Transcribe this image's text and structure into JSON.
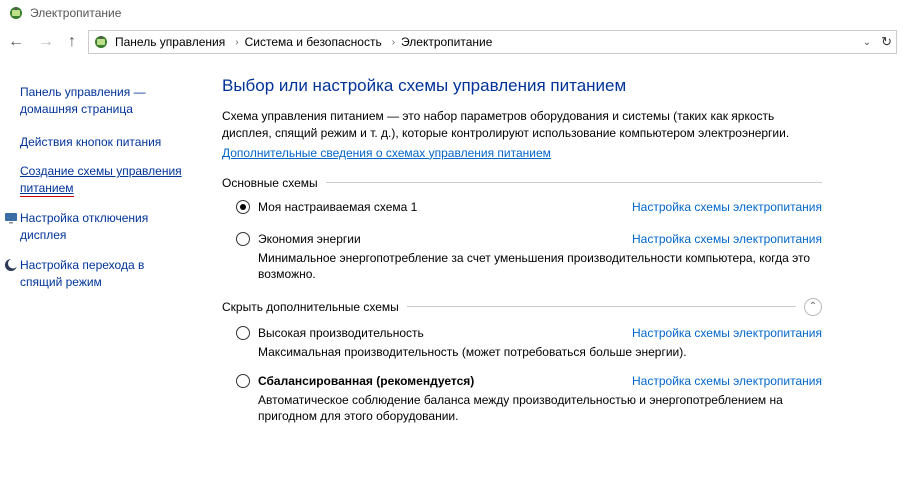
{
  "window": {
    "title": "Электропитание"
  },
  "breadcrumb": {
    "root": "Панель управления",
    "cat": "Система и безопасность",
    "page": "Электропитание"
  },
  "sidebar": {
    "home1": "Панель управления —",
    "home2": "домашняя страница",
    "links": {
      "buttons": "Действия кнопок питания",
      "create1": "Создание схемы управления",
      "create2": "питанием",
      "display1": "Настройка отключения",
      "display2": "дисплея",
      "sleep1": "Настройка перехода в",
      "sleep2": "спящий режим"
    }
  },
  "main": {
    "heading": "Выбор или настройка схемы управления питанием",
    "intro": "Схема управления питанием — это набор параметров оборудования и системы (таких как яркость дисплея, спящий режим и т. д.), которые контролируют использование компьютером электроэнергии.",
    "more": "Дополнительные сведения о схемах управления питанием",
    "group_basic": "Основные схемы",
    "group_extra": "Скрыть дополнительные схемы",
    "cfg_label": "Настройка схемы электропитания",
    "plans": {
      "custom": {
        "name": "Моя настраиваемая схема 1"
      },
      "saver": {
        "name": "Экономия энергии",
        "desc": "Минимальное энергопотребление за счет уменьшения производительности компьютера, когда это возможно."
      },
      "high": {
        "name": "Высокая производительность",
        "desc": "Максимальная производительность (может потребоваться больше энергии)."
      },
      "balanced": {
        "name": "Сбалансированная (рекомендуется)",
        "desc": "Автоматическое соблюдение баланса между производительностью и энергопотреблением на пригодном для этого оборудовании."
      }
    }
  }
}
